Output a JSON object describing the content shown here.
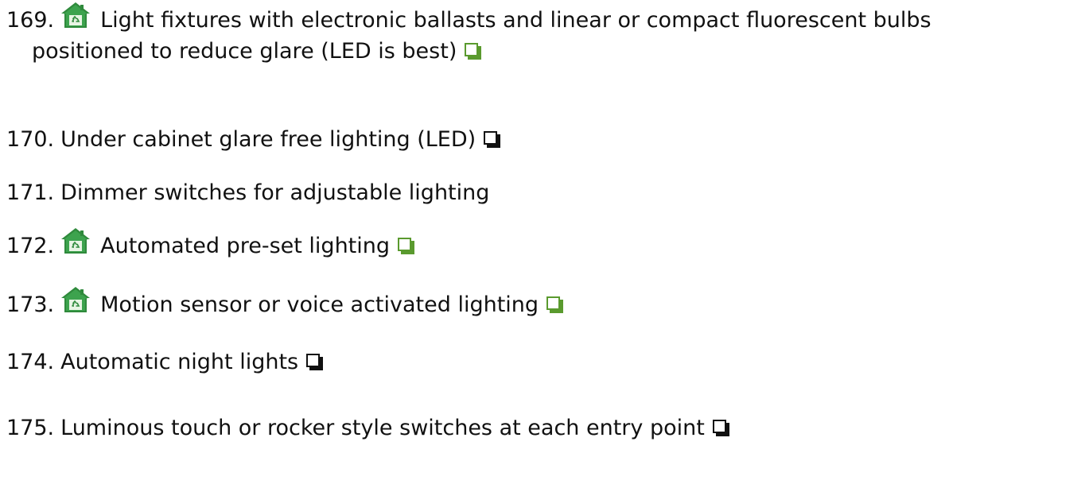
{
  "colors": {
    "text": "#111111",
    "green_checkbox": "#5a9a2e",
    "icon_green": "#2f8a3c"
  },
  "items": [
    {
      "number": "169.",
      "text": "Light fixtures with electronic ballasts and linear or compact fluorescent bulbs",
      "continuation": "positioned to reduce glare (LED is best)",
      "green_icon": "house-recycle-icon",
      "checkbox": "green"
    },
    {
      "number": "170.",
      "text": "Under cabinet glare free lighting (LED)",
      "checkbox": "black"
    },
    {
      "number": "171.",
      "text": "Dimmer switches for adjustable lighting"
    },
    {
      "number": "172.",
      "text": "Automated pre-set lighting",
      "green_icon": "house-recycle-icon",
      "checkbox": "green"
    },
    {
      "number": "173.",
      "text": "Motion sensor or voice activated lighting",
      "green_icon": "house-recycle-icon",
      "checkbox": "green"
    },
    {
      "number": "174.",
      "text": "Automatic night lights",
      "checkbox": "black"
    },
    {
      "number": "175.",
      "text": "Luminous touch or rocker style switches at each entry point",
      "checkbox": "black"
    }
  ]
}
